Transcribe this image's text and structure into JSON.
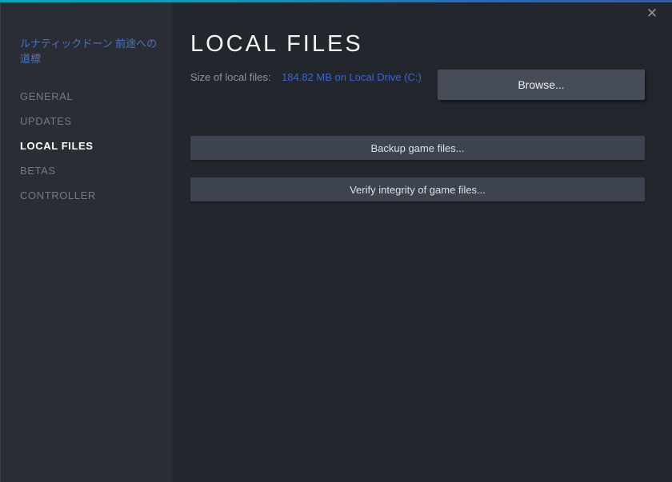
{
  "window": {
    "close_icon": "✕"
  },
  "sidebar": {
    "game_title": "ルナティックドーン 前途への道標",
    "items": [
      {
        "label": "GENERAL",
        "active": false
      },
      {
        "label": "UPDATES",
        "active": false
      },
      {
        "label": "LOCAL FILES",
        "active": true
      },
      {
        "label": "BETAS",
        "active": false
      },
      {
        "label": "CONTROLLER",
        "active": false
      }
    ]
  },
  "main": {
    "title": "LOCAL FILES",
    "size_label": "Size of local files:",
    "size_value": "184.82 MB on Local Drive (C:)",
    "buttons": {
      "browse": "Browse...",
      "backup": "Backup game files...",
      "verify": "Verify integrity of game files..."
    }
  },
  "colors": {
    "accent_gradient_left": "#0aa6bc",
    "accent_gradient_right": "#3a5a9e",
    "sidebar_bg": "#2b2d35",
    "content_bg": "#24262e",
    "game_title_blue": "#4a74c2",
    "link_blue": "#3b64c9",
    "nav_inactive": "#75797f",
    "nav_active": "#ffffff",
    "button_light": "#464d58",
    "button_dark": "#3d4450"
  }
}
